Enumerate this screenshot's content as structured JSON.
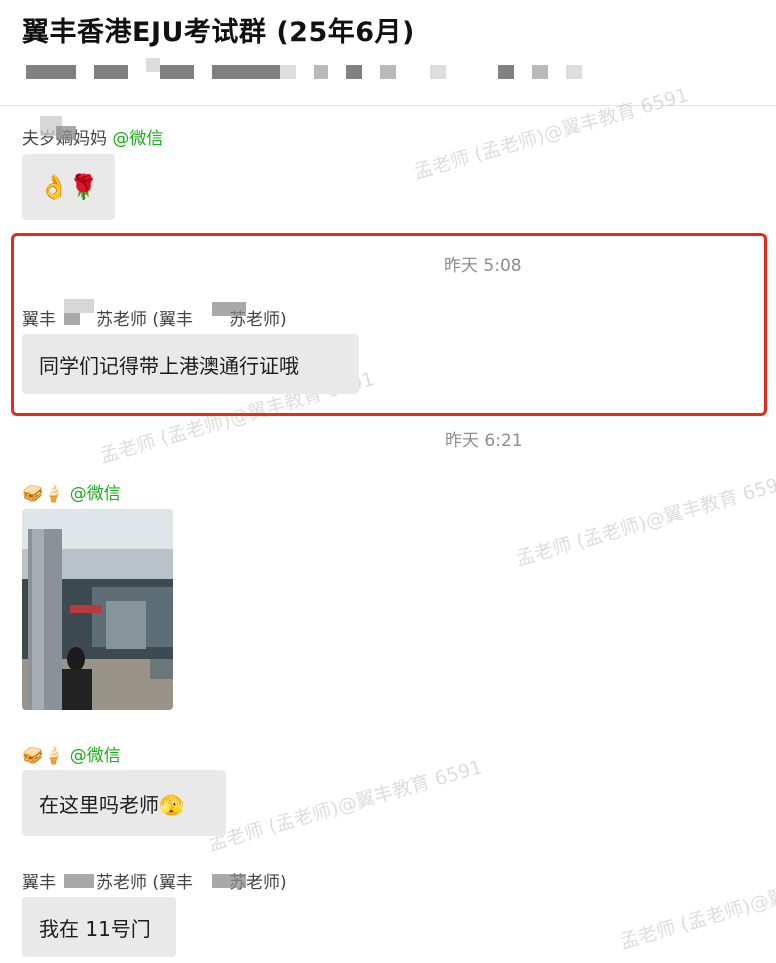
{
  "header": {
    "title": "翼丰香港EJU考试群 (25年6月)"
  },
  "watermark_text": "孟老师 (孟老师)@翼丰教育 6591",
  "messages": [
    {
      "sender": "夫岁嫡妈妈",
      "suffix": "@微信",
      "content": "👌🌹"
    },
    {
      "time": "昨天 5:08",
      "sender": "翼丰",
      "sender_mid": "苏老师 (翼丰",
      "sender_end": "苏老师)",
      "content": "同学们记得带上港澳通行证哦"
    },
    {
      "time": "昨天 6:21",
      "sender_emoji": "🥪🍦",
      "suffix": "@微信",
      "content_type": "image"
    },
    {
      "sender_emoji": "🥪🍦",
      "suffix": "@微信",
      "content": "在这里吗老师🫣"
    },
    {
      "sender": "翼丰",
      "sender_mid": "苏老师 (翼丰",
      "sender_end": "苏老师)",
      "content": "我在 11号门"
    }
  ],
  "colors": {
    "highlight": "#e8291c",
    "wechat_green": "#1aad19",
    "bubble": "#e9e9e9",
    "timestamp": "#8d8d8d"
  }
}
